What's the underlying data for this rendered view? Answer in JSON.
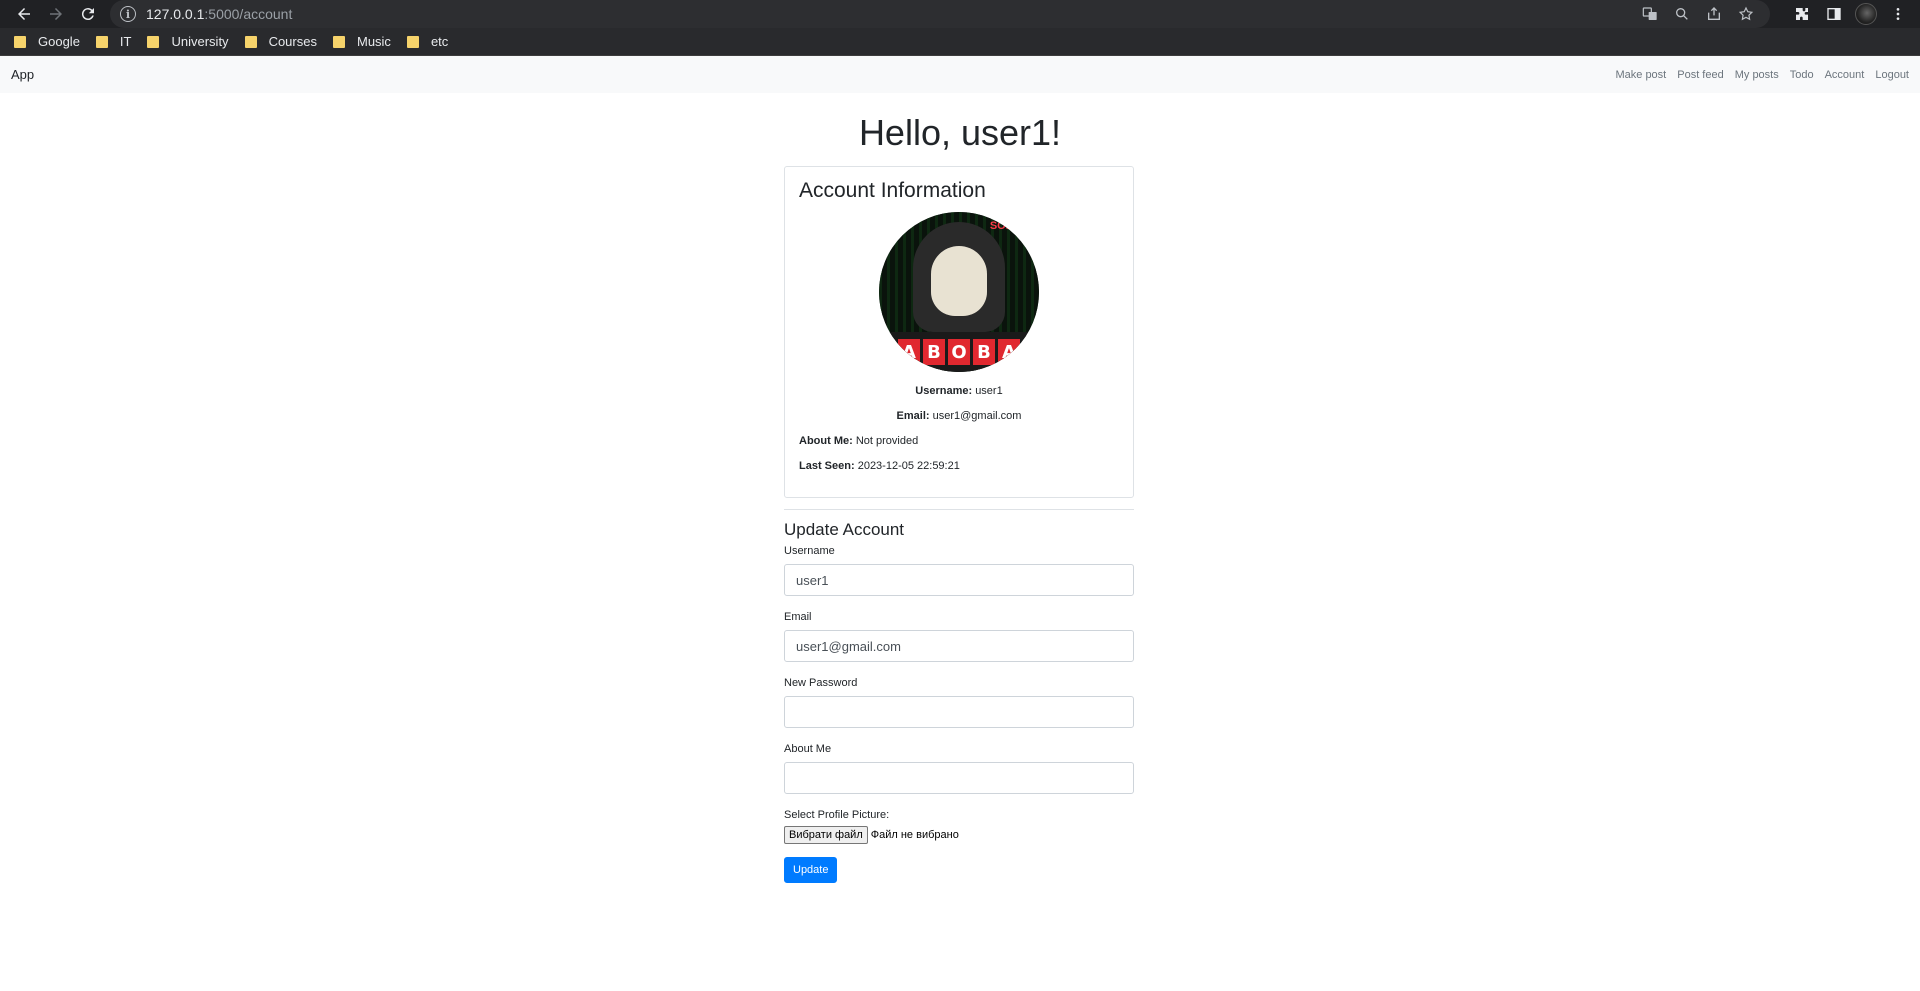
{
  "browser": {
    "url_host": "127.0.0.1",
    "url_path": ":5000/account",
    "bookmarks": [
      {
        "label": "Google"
      },
      {
        "label": "IT"
      },
      {
        "label": "University"
      },
      {
        "label": "Courses"
      },
      {
        "label": "Music"
      },
      {
        "label": "etc"
      }
    ]
  },
  "navbar": {
    "brand": "App",
    "links": [
      "Make post",
      "Post feed",
      "My posts",
      "Todo",
      "Account",
      "Logout"
    ]
  },
  "heading": "Hello, user1!",
  "account_info": {
    "title": "Account Information",
    "avatar_band": [
      "A",
      "B",
      "O",
      "B",
      "A"
    ],
    "avatar_tag": "SOLO",
    "username_label": "Username:",
    "username_value": "user1",
    "email_label": "Email:",
    "email_value": "user1@gmail.com",
    "about_label": "About Me:",
    "about_value": "Not provided",
    "last_seen_label": "Last Seen:",
    "last_seen_value": "2023-12-05 22:59:21"
  },
  "update_form": {
    "title": "Update Account",
    "username_label": "Username",
    "username_value": "user1",
    "email_label": "Email",
    "email_value": "user1@gmail.com",
    "password_label": "New Password",
    "password_value": "",
    "about_label": "About Me",
    "about_value": "",
    "picture_label": "Select Profile Picture:",
    "file_button": "Вибрати файл",
    "file_status": "Файл не вибрано",
    "submit_label": "Update"
  },
  "colors": {
    "primary": "#007bff",
    "navbar_bg": "#f8f9fa",
    "chrome_bg": "#202124"
  }
}
